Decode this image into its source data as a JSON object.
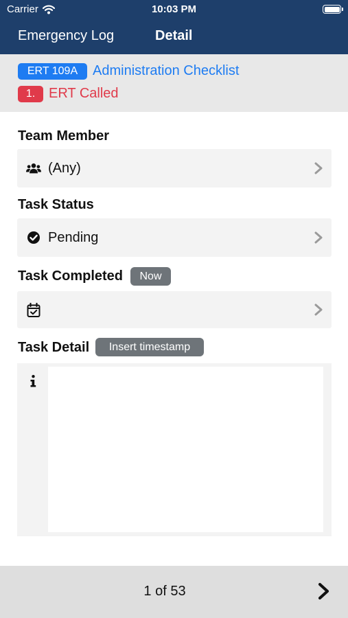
{
  "status_bar": {
    "carrier": "Carrier",
    "time": "10:03 PM"
  },
  "nav": {
    "back_label": "Emergency Log",
    "title": "Detail"
  },
  "header": {
    "code_badge": "ERT 109A",
    "checklist_title": "Administration Checklist",
    "step_badge": "1.",
    "step_title": "ERT Called"
  },
  "team_member": {
    "label": "Team Member",
    "value": "(Any)",
    "icon": "users-icon"
  },
  "task_status": {
    "label": "Task Status",
    "value": "Pending",
    "icon": "check-circle-icon"
  },
  "task_completed": {
    "label": "Task Completed",
    "now_label": "Now",
    "value": "",
    "icon": "calendar-check-icon"
  },
  "task_detail": {
    "label": "Task Detail",
    "insert_label": "Insert timestamp",
    "value": "",
    "icon": "info-icon"
  },
  "pager": {
    "text": "1 of 53"
  },
  "colors": {
    "nav": "#1e3f6b",
    "accent_blue": "#1e7cf2",
    "accent_red": "#e03a4a",
    "pill_gray": "#6e7479"
  }
}
